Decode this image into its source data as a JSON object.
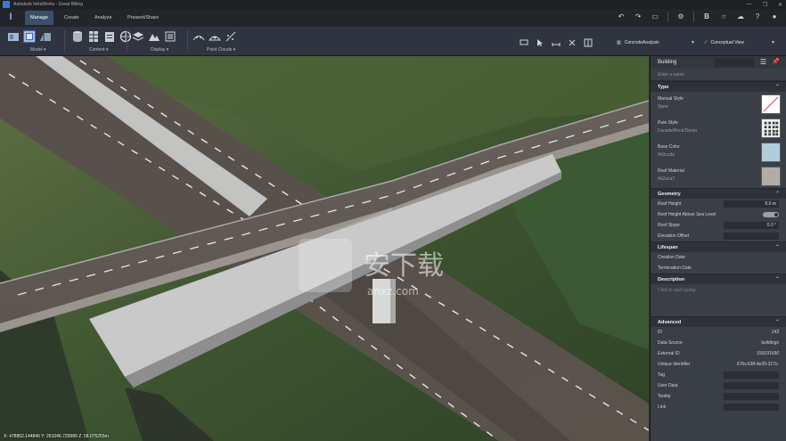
{
  "window": {
    "title": "Autodesk InfraWorks - Great Billing",
    "controls": [
      "—",
      "❐",
      "✕"
    ]
  },
  "tabs": [
    {
      "label": "Manage",
      "active": true
    },
    {
      "label": "Create",
      "active": false
    },
    {
      "label": "Analyze",
      "active": false
    },
    {
      "label": "Present/Share",
      "active": false
    }
  ],
  "ribbon": {
    "groups": [
      {
        "label": "Model"
      },
      {
        "label": "Content"
      },
      {
        "label": "Display"
      },
      {
        "label": "Point Clouds"
      }
    ],
    "style_dropdown": "ConcreteAnalysis",
    "view_dropdown": "Conceptual View"
  },
  "viewport": {
    "coords": "X: 478862.144846 Y: 261046.729989 Z: 58.075255m",
    "watermark": "安下载",
    "watermark_sub": "anxz.com"
  },
  "panel": {
    "title": "Building",
    "name_placeholder": "Enter a name",
    "sections": {
      "type": "Type",
      "geometry": "Geometry",
      "lifespan": "Lifespan",
      "description": "Description",
      "advanced": "Advanced"
    },
    "type_rows": [
      {
        "label": "Manual Style",
        "value": "None",
        "swatch": "#ffffff"
      },
      {
        "label": "Rule Style",
        "value": "Facade/Brick/Doran",
        "swatch": "#e8e8e8"
      },
      {
        "label": "Base Color",
        "value": "#b3ccda",
        "swatch": "#b3ccda"
      },
      {
        "label": "Roof Material",
        "value": "#b2aca7",
        "swatch": "#b2aca7"
      }
    ],
    "geometry_rows": [
      {
        "label": "Roof Height",
        "value": "5.0  m"
      },
      {
        "label": "Roof Height Above Sea Level",
        "value": ""
      },
      {
        "label": "Roof Slope",
        "value": "0.0  °"
      },
      {
        "label": "Elevation Offset",
        "value": ""
      }
    ],
    "lifespan_rows": [
      {
        "label": "Creation Date"
      },
      {
        "label": "Termination Date"
      }
    ],
    "description_placeholder": "Click to start typing...",
    "advanced_rows": [
      {
        "label": "ID",
        "value": "143"
      },
      {
        "label": "Data Source",
        "value": "buildings"
      },
      {
        "label": "External ID",
        "value": "159191690"
      },
      {
        "label": "Unique Identifier",
        "value": "67fcc538-4e39-317c-"
      },
      {
        "label": "Tag",
        "value": ""
      },
      {
        "label": "User Data",
        "value": ""
      },
      {
        "label": "Tooltip",
        "value": ""
      },
      {
        "label": "Link",
        "value": ""
      }
    ]
  }
}
